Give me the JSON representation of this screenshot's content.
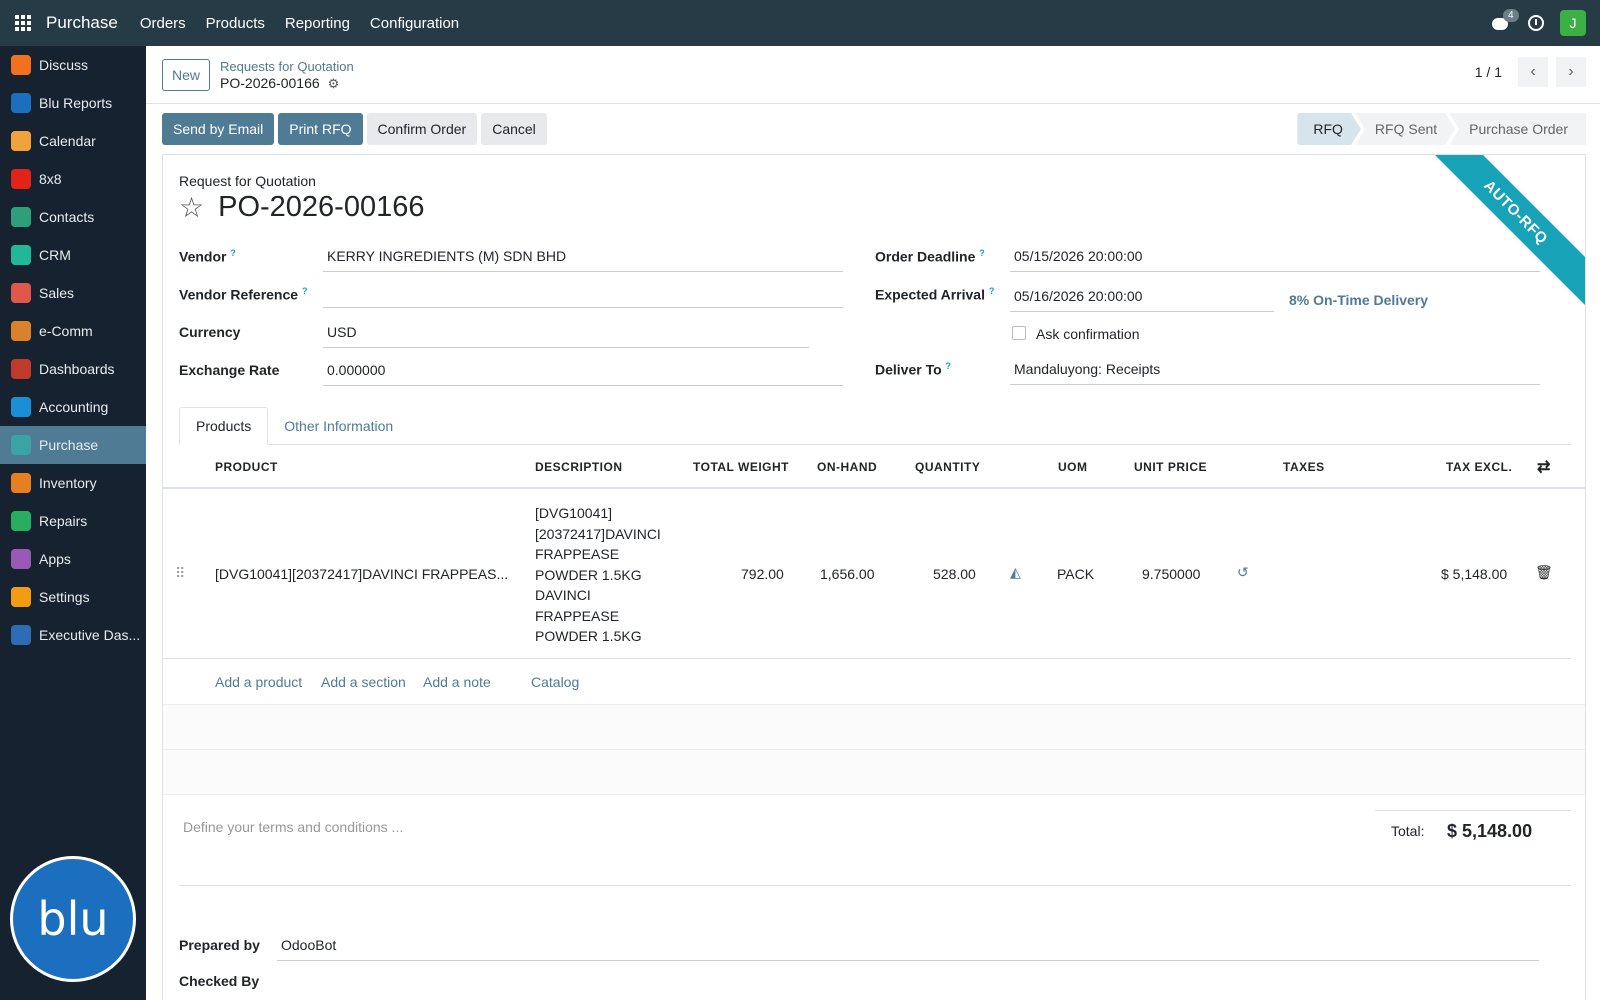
{
  "topbar": {
    "brand": "Purchase",
    "menu": [
      "Orders",
      "Products",
      "Reporting",
      "Configuration"
    ],
    "chat_badge": "4",
    "avatar_letter": "J"
  },
  "sidebar": {
    "items": [
      {
        "label": "Discuss",
        "icon": "discuss-icon",
        "color": "#f2711c"
      },
      {
        "label": "Blu Reports",
        "icon": "blu-reports-icon",
        "color": "#1c6fbf"
      },
      {
        "label": "Calendar",
        "icon": "calendar-icon",
        "color": "#f0a33a"
      },
      {
        "label": "8x8",
        "icon": "8x8-icon",
        "color": "#e2231a"
      },
      {
        "label": "Contacts",
        "icon": "contacts-icon",
        "color": "#2f9e7a"
      },
      {
        "label": "CRM",
        "icon": "crm-icon",
        "color": "#21b799"
      },
      {
        "label": "Sales",
        "icon": "sales-icon",
        "color": "#e2574c"
      },
      {
        "label": "e-Comm",
        "icon": "ecomm-icon",
        "color": "#d9822b"
      },
      {
        "label": "Dashboards",
        "icon": "dashboards-icon",
        "color": "#c0392b"
      },
      {
        "label": "Accounting",
        "icon": "accounting-icon",
        "color": "#1a8fd6"
      },
      {
        "label": "Purchase",
        "icon": "purchase-icon",
        "color": "#3aa3a3"
      },
      {
        "label": "Inventory",
        "icon": "inventory-icon",
        "color": "#e67e22"
      },
      {
        "label": "Repairs",
        "icon": "repairs-icon",
        "color": "#27ae60"
      },
      {
        "label": "Apps",
        "icon": "apps-icon",
        "color": "#9b59b6"
      },
      {
        "label": "Settings",
        "icon": "settings-icon",
        "color": "#f39c12"
      },
      {
        "label": "Executive Das...",
        "icon": "executive-dashboard-icon",
        "color": "#2e6db4"
      }
    ],
    "logo_text": "blu"
  },
  "control_panel": {
    "new_label": "New",
    "breadcrumb_parent": "Requests for Quotation",
    "breadcrumb_current": "PO-2026-00166",
    "pager": "1 / 1"
  },
  "actions": {
    "send_email": "Send by Email",
    "print_rfq": "Print RFQ",
    "confirm_order": "Confirm Order",
    "cancel": "Cancel"
  },
  "status": {
    "stages": [
      "RFQ",
      "RFQ Sent",
      "Purchase Order"
    ]
  },
  "form": {
    "ribbon": "AUTO-RFQ",
    "subtitle": "Request for Quotation",
    "name": "PO-2026-00166",
    "vendor_label": "Vendor",
    "vendor": "KERRY INGREDIENTS (M) SDN BHD",
    "vendor_ref_label": "Vendor Reference",
    "vendor_ref": "",
    "currency_label": "Currency",
    "currency": "USD",
    "exchange_rate_label": "Exchange Rate",
    "exchange_rate": "0.000000",
    "order_deadline_label": "Order Deadline",
    "order_deadline": "05/15/2026 20:00:00",
    "expected_arrival_label": "Expected Arrival",
    "expected_arrival": "05/16/2026 20:00:00",
    "on_time_delivery": "8% On-Time Delivery",
    "ask_confirmation": "Ask confirmation",
    "deliver_to_label": "Deliver To",
    "deliver_to": "Mandaluyong: Receipts",
    "help_mark": "?"
  },
  "tabs": [
    "Products",
    "Other Information"
  ],
  "table": {
    "columns": [
      "PRODUCT",
      "DESCRIPTION",
      "TOTAL WEIGHT",
      "ON-HAND",
      "QUANTITY",
      "UOM",
      "UNIT PRICE",
      "TAXES",
      "TAX EXCL."
    ],
    "rows": [
      {
        "product": "[DVG10041][20372417]DAVINCI FRAPPEAS...",
        "description": "[DVG10041] [20372417]DAVINCI FRAPPEASE POWDER 1.5KG DAVINCI FRAPPEASE POWDER 1.5KG",
        "total_weight": "792.00",
        "on_hand": "1,656.00",
        "quantity": "528.00",
        "uom": "PACK",
        "unit_price": "9.750000",
        "taxes": "",
        "tax_excl": "$ 5,148.00"
      }
    ],
    "add_product": "Add a product",
    "add_section": "Add a section",
    "add_note": "Add a note",
    "catalog": "Catalog"
  },
  "footer": {
    "terms_placeholder": "Define your terms and conditions ...",
    "total_label": "Total:",
    "total_value": "$ 5,148.00",
    "prepared_by_label": "Prepared by",
    "prepared_by": "OdooBot",
    "checked_by_label": "Checked By"
  }
}
